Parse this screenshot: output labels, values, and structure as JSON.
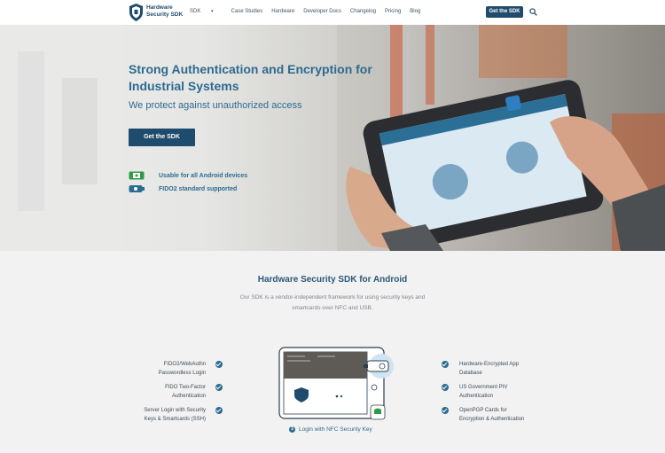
{
  "nav": {
    "brand_line1": "Hardware",
    "brand_line2": "Security SDK",
    "menu": [
      "SDK",
      "Case Studies",
      "Hardware",
      "Developer Docs",
      "Changelog",
      "Pricing",
      "Blog"
    ],
    "cta": "Get the SDK",
    "icons": [
      "shield-logo-icon",
      "search-icon",
      "caret-down-icon"
    ]
  },
  "hero": {
    "title": "Strong Authentication and Encryption for Industrial Systems",
    "subtitle": "We protect against unauthorized access",
    "cta": "Get the SDK",
    "features": [
      "Usable for all Android devices",
      "FIDO2 standard supported"
    ]
  },
  "section": {
    "title": "Hardware Security SDK for Android",
    "description": "Our SDK is a vendor-independent framework for using security keys and smartcards over NFC and USB.",
    "left_items": [
      {
        "line1": "FIDO2/WebAuthn",
        "line2": "Passwordless Login"
      },
      {
        "line1": "FIDO Two-Factor",
        "line2": "Authentication"
      },
      {
        "line1": "Server Login with Security",
        "line2": "Keys & Smartcards (SSH)"
      }
    ],
    "right_items": [
      {
        "line1": "Hardware-Encrypted App",
        "line2": "Database"
      },
      {
        "line1": "US Government PIV",
        "line2": "Authentication"
      },
      {
        "line1": "OpenPGP Cards for",
        "line2": "Encryption & Authentication"
      }
    ],
    "caption_num": "3",
    "caption": "Login with NFC Security Key"
  },
  "colors": {
    "primary": "#1f4c6c",
    "accent": "#2d6b8f",
    "hero_title": "#2d6b8f"
  }
}
